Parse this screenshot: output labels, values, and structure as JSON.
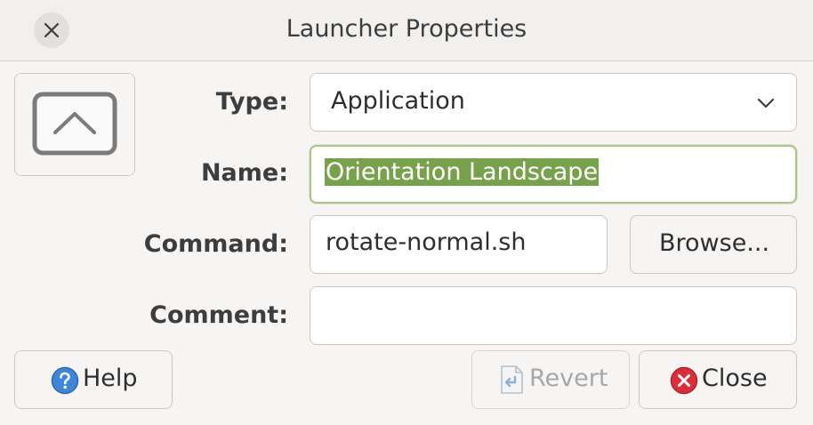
{
  "window": {
    "title": "Launcher Properties"
  },
  "icons": {
    "close": "close-icon",
    "launcher": "chevron-up-screen-icon",
    "dropdown": "chevron-down-icon",
    "help": "help-icon",
    "revert": "revert-icon",
    "close_button": "close-circle-icon"
  },
  "form": {
    "type_label": "Type:",
    "type_value": "Application",
    "name_label": "Name:",
    "name_value": "Orientation Landscape",
    "command_label": "Command:",
    "command_value": "rotate-normal.sh",
    "browse_label": "Browse...",
    "comment_label": "Comment:",
    "comment_value": ""
  },
  "buttons": {
    "help": "Help",
    "revert": "Revert",
    "close": "Close"
  },
  "colors": {
    "selection": "#77a14a",
    "focus_border": "#a9c587",
    "help_blue": "#3f86d8",
    "close_red": "#d92f3a"
  }
}
